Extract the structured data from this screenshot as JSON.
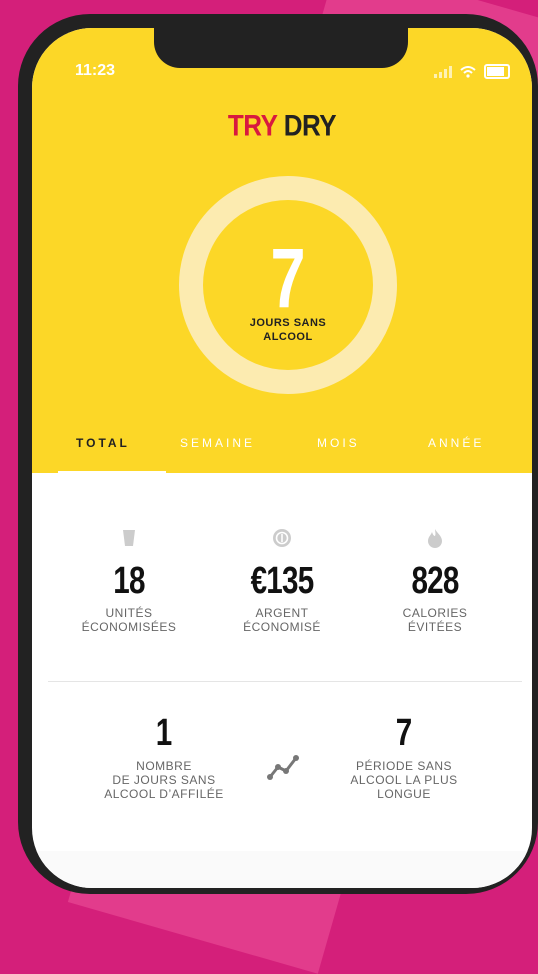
{
  "status_bar": {
    "time": "11:23"
  },
  "header": {
    "title_part1": "TRY",
    "title_part2": "DRY"
  },
  "ring": {
    "value": "7",
    "label_line1": "JOURS SANS",
    "label_line2": "ALCOOL"
  },
  "tabs": [
    {
      "label": "TOTAL",
      "active": true
    },
    {
      "label": "SEMAINE"
    },
    {
      "label": "MOIS"
    },
    {
      "label": "ANNÉE"
    }
  ],
  "stats": [
    {
      "icon": "glass-icon",
      "value": "18",
      "label_line1": "UNITÉS",
      "label_line2": "ÉCONOMISÉES"
    },
    {
      "icon": "coin-icon",
      "value": "€135",
      "label_line1": "ARGENT",
      "label_line2": "ÉCONOMISÉ"
    },
    {
      "icon": "flame-icon",
      "value": "828",
      "label_line1": "CALORIES",
      "label_line2": "ÉVITÉES"
    }
  ],
  "streaks": {
    "current": {
      "value": "1",
      "label_line1": "NOMBRE",
      "label_line2": "DE JOURS SANS",
      "label_line3": "ALCOOL D’AFFILÉE"
    },
    "longest": {
      "value": "7",
      "label_line1": "PÉRIODE SANS",
      "label_line2": "ALCOOL LA PLUS",
      "label_line3": "LONGUE"
    },
    "icon": "trend-line-icon"
  },
  "colors": {
    "yellow": "#fcd727",
    "pink": "#d41f7a",
    "accent_red": "#d8193f"
  }
}
